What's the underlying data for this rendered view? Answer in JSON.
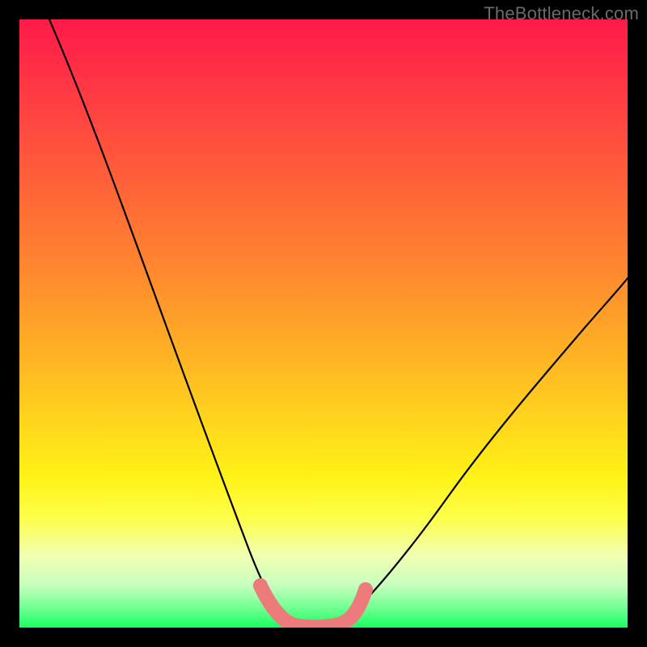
{
  "watermark": "TheBottleneck.com",
  "chart_data": {
    "type": "line",
    "title": "",
    "xlabel": "",
    "ylabel": "",
    "xlim": [
      0,
      100
    ],
    "ylim": [
      0,
      100
    ],
    "grid": false,
    "legend": false,
    "annotations": [],
    "series": [
      {
        "name": "black-curve",
        "color": "#000000",
        "x": [
          5,
          10,
          15,
          20,
          25,
          30,
          35,
          37,
          40,
          42,
          45,
          48,
          50,
          55,
          60,
          65,
          70,
          75,
          80,
          85,
          90,
          95,
          100
        ],
        "y": [
          100,
          85,
          70,
          56,
          43,
          31,
          20,
          15,
          8,
          4,
          1,
          0,
          0,
          2,
          7,
          13,
          20,
          27,
          34,
          41,
          47,
          54,
          60
        ]
      },
      {
        "name": "pink-bottom-segment",
        "color": "#ee7b7b",
        "x": [
          40,
          42,
          45,
          48,
          50,
          53,
          55
        ],
        "y": [
          5,
          2,
          0,
          0,
          0,
          2,
          5
        ]
      }
    ],
    "gradient_stops": [
      {
        "pos": 0,
        "color": "#ff1a49"
      },
      {
        "pos": 8,
        "color": "#ff2f46"
      },
      {
        "pos": 18,
        "color": "#ff4a3f"
      },
      {
        "pos": 30,
        "color": "#ff6a36"
      },
      {
        "pos": 42,
        "color": "#ff8a2e"
      },
      {
        "pos": 55,
        "color": "#ffb224"
      },
      {
        "pos": 66,
        "color": "#ffd51c"
      },
      {
        "pos": 75,
        "color": "#fff215"
      },
      {
        "pos": 82,
        "color": "#fdff4a"
      },
      {
        "pos": 88,
        "color": "#f2ffb0"
      },
      {
        "pos": 93,
        "color": "#c8ffbf"
      },
      {
        "pos": 97,
        "color": "#6cff8f"
      },
      {
        "pos": 100,
        "color": "#17ff61"
      }
    ]
  }
}
